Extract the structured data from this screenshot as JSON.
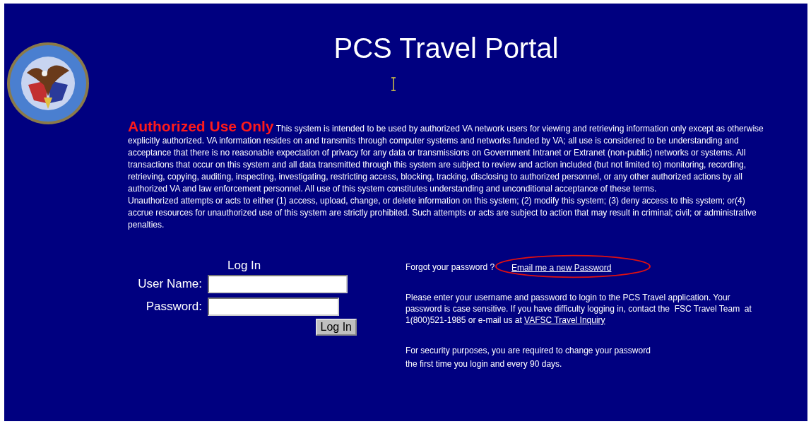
{
  "title": "PCS Travel Portal",
  "notice": {
    "heading": "Authorized Use Only",
    "text": "This system is intended to be used by authorized VA network users for viewing and retrieving information only except as otherwise explicitly authorized. VA information resides on and transmits through computer systems and networks funded by VA; all use is considered to be understanding and acceptance that there is no reasonable expectation of privacy for any data or transmissions on Government Intranet or Extranet (non-public) networks or systems. All transactions that occur on this system and all data transmitted through this system are subject to review and action included (but not limited to) monitoring, recording, retrieving, copying, auditing, inspecting, investigating, restricting access, blocking, tracking, disclosing to authorized personnel, or any other authorized actions by all authorized VA and law enforcement personnel. All use of this system constitutes understanding and unconditional acceptance of these terms.",
    "text_2": "Unauthorized attempts or acts to either (1) access, upload, change, or delete information on this system; (2) modify this system; (3) deny access to this system; or(4) accrue resources for unauthorized use of this system are strictly prohibited. Such attempts or acts are subject to action that may result in criminal; civil; or administrative penalties."
  },
  "login": {
    "heading": "Log In",
    "fields": [
      {
        "label": "User Name:"
      },
      {
        "label": "Password:"
      }
    ],
    "button": "Log In"
  },
  "help": {
    "forgot_label": "Forgot your password ?",
    "forgot_link": "Email me a new Password",
    "instructions": "Please enter your username and password to login to the PCS Travel application. Your password is case sensitive. If you have difficulty logging in, contact the  FSC Travel Team  at  1(800)521-1985 or e-mail us at ",
    "contact_link": "VAFSC Travel Inquiry",
    "security_1": "For security purposes, you are required to change your password",
    "security_2": "the first time you login and every 90 days."
  }
}
